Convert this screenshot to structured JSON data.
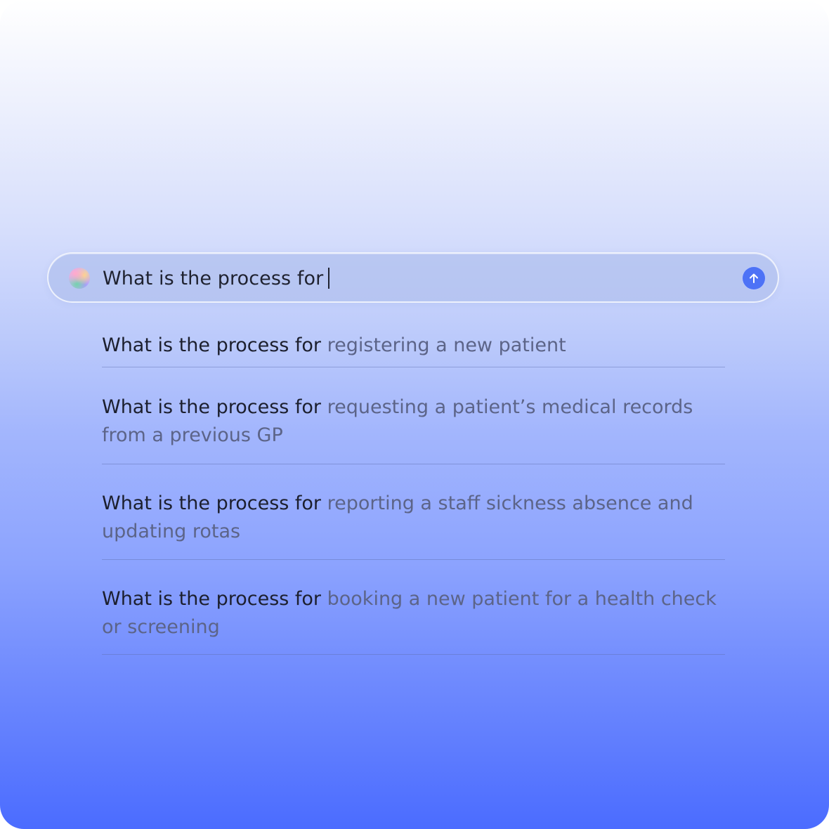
{
  "search": {
    "query": "What is the process for",
    "icon": "assistant-orb-icon",
    "send_icon": "arrow-up-icon",
    "accent_color": "#4d72f6"
  },
  "suggestions": [
    {
      "prefix": "What is the process for",
      "completion": "registering a new patient"
    },
    {
      "prefix": "What is the process for",
      "completion": "requesting a patient’s medical records from a previous GP"
    },
    {
      "prefix": "What is the process for",
      "completion": "reporting a staff sickness absence and updating rotas"
    },
    {
      "prefix": "What is the process for",
      "completion": "booking a new patient for a health check or screening"
    }
  ],
  "colors": {
    "gradient_top": "#ffffff",
    "gradient_bottom": "#4b6cff",
    "typed_text": "#1f2230",
    "completion_text": "#5c6488"
  }
}
